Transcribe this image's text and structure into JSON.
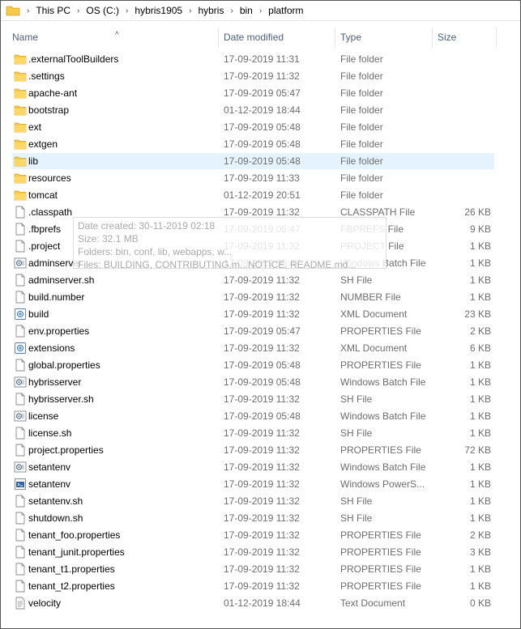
{
  "breadcrumb": [
    "This PC",
    "OS (C:)",
    "hybris1905",
    "hybris",
    "bin",
    "platform"
  ],
  "columns": {
    "name": "Name",
    "date": "Date modified",
    "type": "Type",
    "size": "Size"
  },
  "files": [
    {
      "name": ".externalToolBuilders",
      "date": "17-09-2019 11:31",
      "type": "File folder",
      "size": "",
      "icon": "folder-icon"
    },
    {
      "name": ".settings",
      "date": "17-09-2019 11:32",
      "type": "File folder",
      "size": "",
      "icon": "folder-icon"
    },
    {
      "name": "apache-ant",
      "date": "17-09-2019 05:47",
      "type": "File folder",
      "size": "",
      "icon": "folder-icon"
    },
    {
      "name": "bootstrap",
      "date": "01-12-2019 18:44",
      "type": "File folder",
      "size": "",
      "icon": "folder-icon"
    },
    {
      "name": "ext",
      "date": "17-09-2019 05:48",
      "type": "File folder",
      "size": "",
      "icon": "folder-icon"
    },
    {
      "name": "extgen",
      "date": "17-09-2019 05:48",
      "type": "File folder",
      "size": "",
      "icon": "folder-icon"
    },
    {
      "name": "lib",
      "date": "17-09-2019 05:48",
      "type": "File folder",
      "size": "",
      "icon": "folder-icon",
      "selected": true
    },
    {
      "name": "resources",
      "date": "17-09-2019 11:33",
      "type": "File folder",
      "size": "",
      "icon": "folder-icon"
    },
    {
      "name": "tomcat",
      "date": "01-12-2019 20:51",
      "type": "File folder",
      "size": "",
      "icon": "folder-icon"
    },
    {
      "name": ".classpath",
      "date": "17-09-2019 11:32",
      "type": "CLASSPATH File",
      "size": "26 KB",
      "icon": "file-icon"
    },
    {
      "name": ".fbprefs",
      "date": "17-09-2019 05:47",
      "type": "FBPREFS File",
      "size": "9 KB",
      "icon": "file-icon"
    },
    {
      "name": ".project",
      "date": "17-09-2019 11:32",
      "type": "PROJECT File",
      "size": "1 KB",
      "icon": "file-icon"
    },
    {
      "name": "adminserver",
      "date": "17-09-2019 05:47",
      "type": "Windows Batch File",
      "size": "1 KB",
      "icon": "batch-file-icon"
    },
    {
      "name": "adminserver.sh",
      "date": "17-09-2019 11:32",
      "type": "SH File",
      "size": "1 KB",
      "icon": "file-icon"
    },
    {
      "name": "build.number",
      "date": "17-09-2019 11:32",
      "type": "NUMBER File",
      "size": "1 KB",
      "icon": "file-icon"
    },
    {
      "name": "build",
      "date": "17-09-2019 11:32",
      "type": "XML Document",
      "size": "23 KB",
      "icon": "xml-file-icon"
    },
    {
      "name": "env.properties",
      "date": "17-09-2019 05:47",
      "type": "PROPERTIES File",
      "size": "2 KB",
      "icon": "file-icon"
    },
    {
      "name": "extensions",
      "date": "17-09-2019 11:32",
      "type": "XML Document",
      "size": "6 KB",
      "icon": "xml-file-icon"
    },
    {
      "name": "global.properties",
      "date": "17-09-2019 05:48",
      "type": "PROPERTIES File",
      "size": "1 KB",
      "icon": "file-icon"
    },
    {
      "name": "hybrisserver",
      "date": "17-09-2019 05:48",
      "type": "Windows Batch File",
      "size": "1 KB",
      "icon": "batch-file-icon"
    },
    {
      "name": "hybrisserver.sh",
      "date": "17-09-2019 11:32",
      "type": "SH File",
      "size": "1 KB",
      "icon": "file-icon"
    },
    {
      "name": "license",
      "date": "17-09-2019 05:48",
      "type": "Windows Batch File",
      "size": "1 KB",
      "icon": "batch-file-icon"
    },
    {
      "name": "license.sh",
      "date": "17-09-2019 11:32",
      "type": "SH File",
      "size": "1 KB",
      "icon": "file-icon"
    },
    {
      "name": "project.properties",
      "date": "17-09-2019 11:32",
      "type": "PROPERTIES File",
      "size": "72 KB",
      "icon": "file-icon"
    },
    {
      "name": "setantenv",
      "date": "17-09-2019 11:32",
      "type": "Windows Batch File",
      "size": "1 KB",
      "icon": "batch-file-icon"
    },
    {
      "name": "setantenv",
      "date": "17-09-2019 11:32",
      "type": "Windows PowerS...",
      "size": "1 KB",
      "icon": "powershell-file-icon"
    },
    {
      "name": "setantenv.sh",
      "date": "17-09-2019 11:32",
      "type": "SH File",
      "size": "1 KB",
      "icon": "file-icon"
    },
    {
      "name": "shutdown.sh",
      "date": "17-09-2019 11:32",
      "type": "SH File",
      "size": "1 KB",
      "icon": "file-icon"
    },
    {
      "name": "tenant_foo.properties",
      "date": "17-09-2019 11:32",
      "type": "PROPERTIES File",
      "size": "2 KB",
      "icon": "file-icon"
    },
    {
      "name": "tenant_junit.properties",
      "date": "17-09-2019 11:32",
      "type": "PROPERTIES File",
      "size": "3 KB",
      "icon": "file-icon"
    },
    {
      "name": "tenant_t1.properties",
      "date": "17-09-2019 11:32",
      "type": "PROPERTIES File",
      "size": "1 KB",
      "icon": "file-icon"
    },
    {
      "name": "tenant_t2.properties",
      "date": "17-09-2019 11:32",
      "type": "PROPERTIES File",
      "size": "1 KB",
      "icon": "file-icon"
    },
    {
      "name": "velocity",
      "date": "01-12-2019 18:44",
      "type": "Text Document",
      "size": "0 KB",
      "icon": "text-file-icon"
    }
  ],
  "tooltip": {
    "created": "Date created: 30-11-2019 02:18",
    "size": "Size: 32.1 MB",
    "folders": "Folders: bin, conf, lib, webapps, w...",
    "files": "Files: BUILDING, CONTRIBUTING.m...NOTICE, README.md..."
  },
  "colors": {
    "selection": "#e5f3ff",
    "folder": "#f7c948",
    "header_text": "#4c607a",
    "meta_text": "#6d6d6d"
  }
}
